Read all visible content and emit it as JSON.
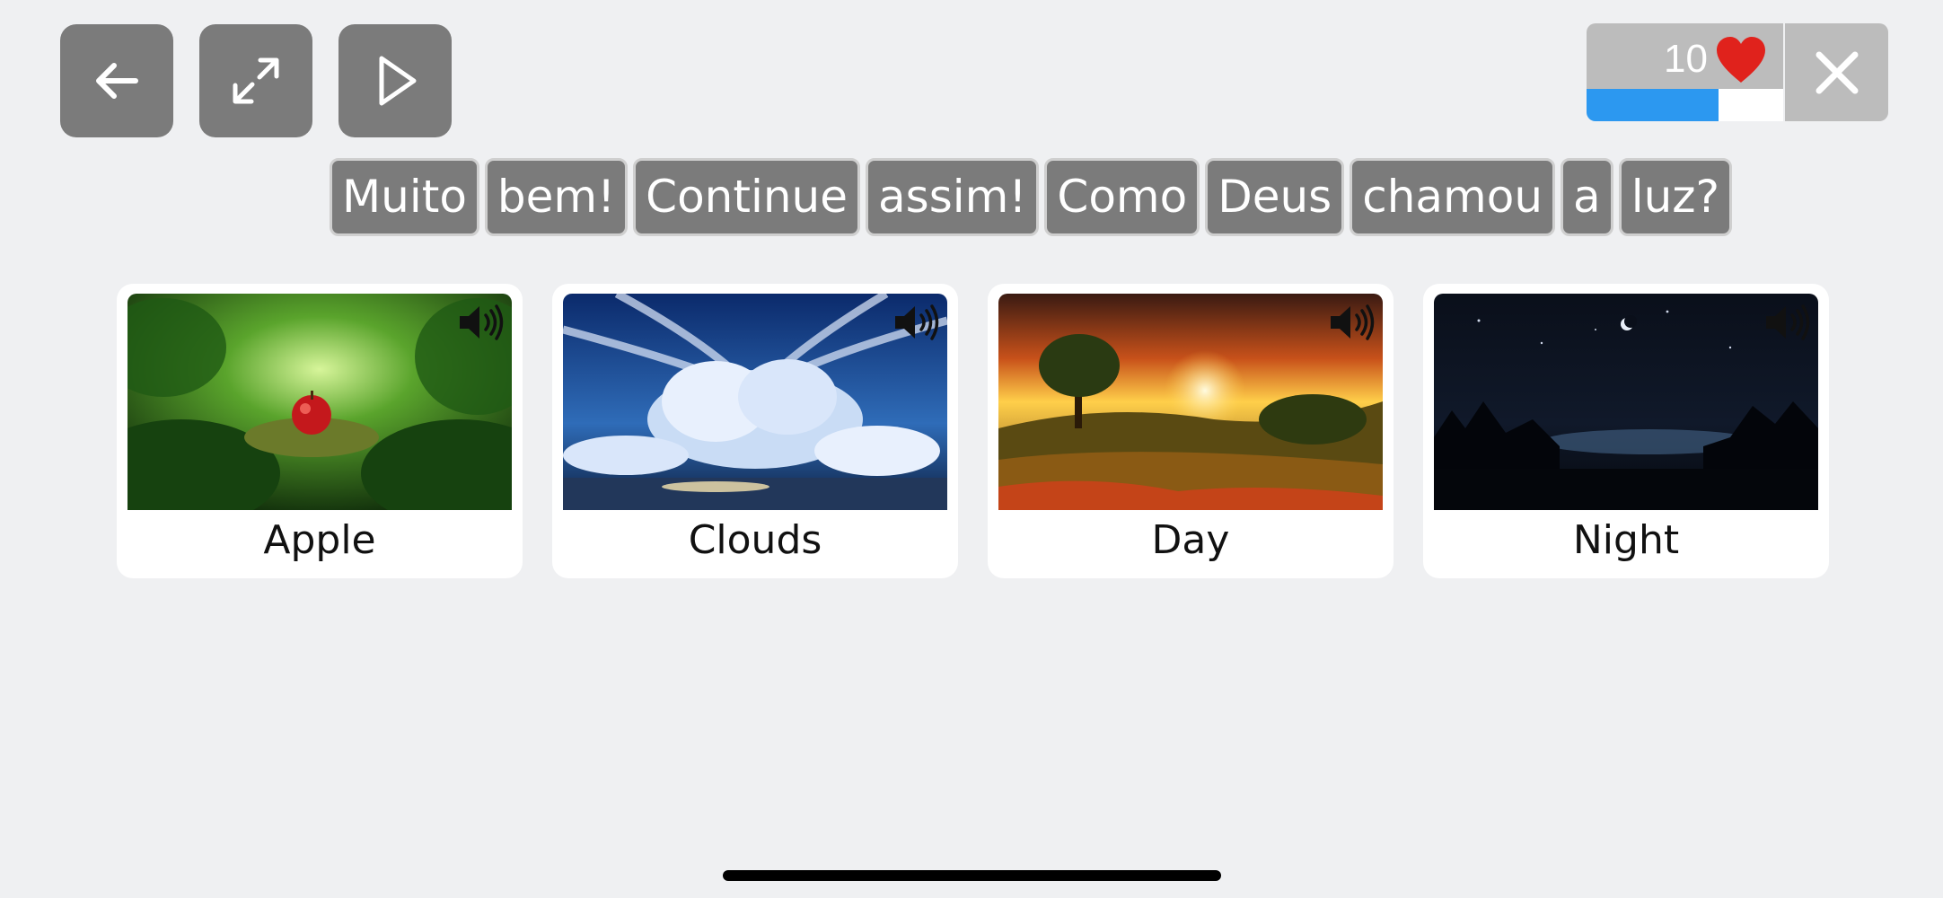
{
  "toolbar": {
    "back_icon": "arrow-left-icon",
    "fullscreen_icon": "expand-arrows-icon",
    "play_icon": "play-triangle-icon"
  },
  "score": {
    "lives": "10",
    "heart_icon": "heart-icon",
    "heart_color": "#e0221c",
    "progress_fraction": 0.67,
    "progress_color": "#2c98f0",
    "close_icon": "close-x-icon"
  },
  "sentence": {
    "words": [
      "Muito",
      "bem!",
      "Continue",
      "assim!",
      "Como",
      "Deus",
      "chamou",
      "a",
      "luz?"
    ]
  },
  "cards": [
    {
      "label": "Apple",
      "image": "apple-forest-image",
      "audio_icon": "speaker-icon"
    },
    {
      "label": "Clouds",
      "image": "clouds-sky-image",
      "audio_icon": "speaker-icon"
    },
    {
      "label": "Day",
      "image": "sunset-landscape-image",
      "audio_icon": "speaker-icon"
    },
    {
      "label": "Night",
      "image": "night-landscape-image",
      "audio_icon": "speaker-icon"
    }
  ]
}
